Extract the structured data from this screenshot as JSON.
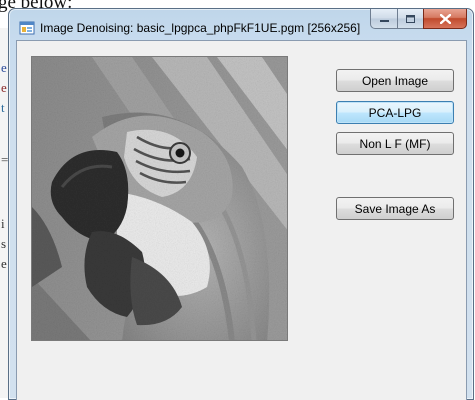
{
  "background_doc": {
    "caption": "ge below:",
    "gutter_chars": [
      "e",
      "e",
      "t",
      "=",
      "i",
      "s",
      "e"
    ]
  },
  "window": {
    "title": "Image Denoising: basic_lpgpca_phpFkF1UE.pgm [256x256]",
    "app_icon": "windows-form-icon",
    "caption_buttons": {
      "minimize": "minimize-icon",
      "maximize": "maximize-icon",
      "close": "close-icon"
    }
  },
  "picture": {
    "subject": "parrot",
    "image_size": "256x256",
    "colormap": "grayscale"
  },
  "buttons": {
    "open_image": "Open Image",
    "pca_lpg": "PCA-LPG",
    "non_lf": "Non L F (MF)",
    "save_image_as": "Save Image As"
  }
}
